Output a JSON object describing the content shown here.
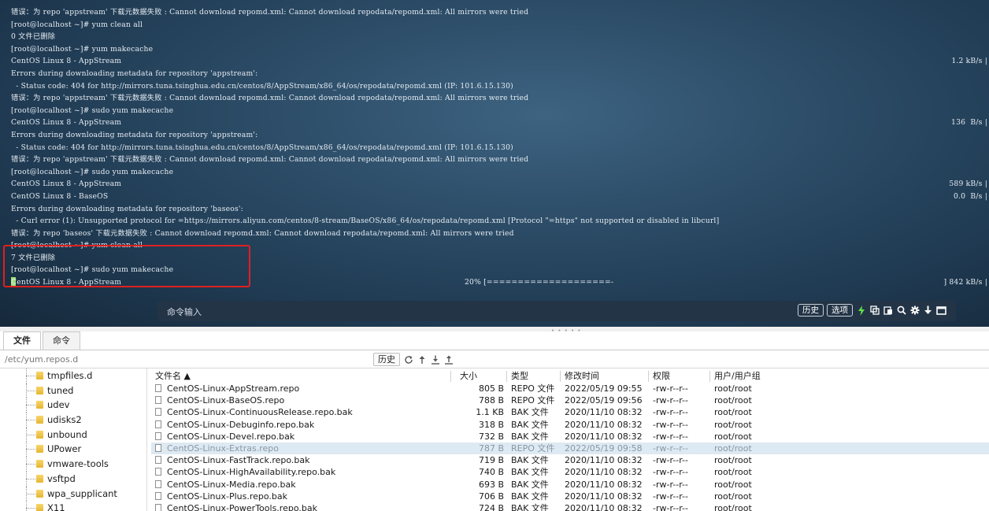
{
  "terminal": {
    "lines": [
      {
        "text": "错误：为 repo 'appstream' 下载元数据失败 : Cannot download repomd.xml: Cannot download repodata/repomd.xml: All mirrors were tried",
        "right": ""
      },
      {
        "text": "[root@localhost ~]# yum clean all",
        "right": ""
      },
      {
        "text": "0 文件已删除",
        "right": ""
      },
      {
        "text": "[root@localhost ~]# yum makecache",
        "right": ""
      },
      {
        "text": "CentOS Linux 8 - AppStream",
        "right": "1.2 kB/s |"
      },
      {
        "text": "Errors during downloading metadata for repository 'appstream':",
        "right": ""
      },
      {
        "text": "  - Status code: 404 for http://mirrors.tuna.tsinghua.edu.cn/centos/8/AppStream/x86_64/os/repodata/repomd.xml (IP: 101.6.15.130)",
        "right": ""
      },
      {
        "text": "错误：为 repo 'appstream' 下载元数据失败 : Cannot download repomd.xml: Cannot download repodata/repomd.xml: All mirrors were tried",
        "right": ""
      },
      {
        "text": "[root@localhost ~]# sudo yum makecache",
        "right": ""
      },
      {
        "text": "CentOS Linux 8 - AppStream",
        "right": "136  B/s |"
      },
      {
        "text": "Errors during downloading metadata for repository 'appstream':",
        "right": ""
      },
      {
        "text": "  - Status code: 404 for http://mirrors.tuna.tsinghua.edu.cn/centos/8/AppStream/x86_64/os/repodata/repomd.xml (IP: 101.6.15.130)",
        "right": ""
      },
      {
        "text": "错误：为 repo 'appstream' 下载元数据失败 : Cannot download repomd.xml: Cannot download repodata/repomd.xml: All mirrors were tried",
        "right": ""
      },
      {
        "text": "[root@localhost ~]# sudo yum makecache",
        "right": ""
      },
      {
        "text": "CentOS Linux 8 - AppStream",
        "right": "589 kB/s |"
      },
      {
        "text": "CentOS Linux 8 - BaseOS",
        "right": "0.0  B/s |"
      },
      {
        "text": "Errors during downloading metadata for repository 'baseos':",
        "right": ""
      },
      {
        "text": "  - Curl error (1): Unsupported protocol for =https://mirrors.aliyun.com/centos/8-stream/BaseOS/x86_64/os/repodata/repomd.xml [Protocol \"=https\" not supported or disabled in libcurl]",
        "right": ""
      },
      {
        "text": "错误：为 repo 'baseos' 下载元数据失败 : Cannot download repomd.xml: Cannot download repodata/repomd.xml: All mirrors were tried",
        "right": ""
      },
      {
        "text": "[root@localhost ~]# yum clean all",
        "right": ""
      },
      {
        "text": "7 文件已删除",
        "right": ""
      },
      {
        "text": "[root@localhost ~]# sudo yum makecache",
        "right": ""
      }
    ],
    "last_line": {
      "text": "CentOS Linux 8 - AppStream",
      "progress": "20% [====================-",
      "right": "] 842 kB/s |"
    },
    "highlight_color": "#e02020",
    "cursor_color": "#9fe07a"
  },
  "command_bar": {
    "placeholder": "命令输入",
    "history_label": "历史",
    "options_label": "选项",
    "icons": [
      "lightning-icon",
      "copy-icon",
      "paste-icon",
      "search-icon",
      "gear-icon",
      "download-arrow-icon",
      "window-icon"
    ]
  },
  "tabs": [
    {
      "label": "文件",
      "active": true
    },
    {
      "label": "命令",
      "active": false
    }
  ],
  "pathbar": {
    "path": "/etc/yum.repos.d",
    "history_label": "历史",
    "icons": [
      "refresh-icon",
      "up-dir-icon",
      "download-icon",
      "upload-icon"
    ]
  },
  "tree": {
    "items": [
      "tmpfiles.d",
      "tuned",
      "udev",
      "udisks2",
      "unbound",
      "UPower",
      "vmware-tools",
      "vsftpd",
      "wpa_supplicant",
      "X11"
    ]
  },
  "files": {
    "columns": {
      "name": "文件名 ▲",
      "size": "大小",
      "type": "类型",
      "mtime": "修改时间",
      "perm": "权限",
      "owner": "用户/用户组"
    },
    "rows": [
      {
        "name": "CentOS-Linux-AppStream.repo",
        "size": "805 B",
        "type": "REPO 文件",
        "mtime": "2022/05/19 09:55",
        "perm": "-rw-r--r--",
        "owner": "root/root"
      },
      {
        "name": "CentOS-Linux-BaseOS.repo",
        "size": "788 B",
        "type": "REPO 文件",
        "mtime": "2022/05/19 09:56",
        "perm": "-rw-r--r--",
        "owner": "root/root"
      },
      {
        "name": "CentOS-Linux-ContinuousRelease.repo.bak",
        "size": "1.1 KB",
        "type": "BAK 文件",
        "mtime": "2020/11/10 08:32",
        "perm": "-rw-r--r--",
        "owner": "root/root"
      },
      {
        "name": "CentOS-Linux-Debuginfo.repo.bak",
        "size": "318 B",
        "type": "BAK 文件",
        "mtime": "2020/11/10 08:32",
        "perm": "-rw-r--r--",
        "owner": "root/root"
      },
      {
        "name": "CentOS-Linux-Devel.repo.bak",
        "size": "732 B",
        "type": "BAK 文件",
        "mtime": "2020/11/10 08:32",
        "perm": "-rw-r--r--",
        "owner": "root/root"
      },
      {
        "name": "CentOS-Linux-Extras.repo",
        "size": "787 B",
        "type": "REPO 文件",
        "mtime": "2022/05/19 09:58",
        "perm": "-rw-r--r--",
        "owner": "root/root",
        "selected": true
      },
      {
        "name": "CentOS-Linux-FastTrack.repo.bak",
        "size": "719 B",
        "type": "BAK 文件",
        "mtime": "2020/11/10 08:32",
        "perm": "-rw-r--r--",
        "owner": "root/root"
      },
      {
        "name": "CentOS-Linux-HighAvailability.repo.bak",
        "size": "740 B",
        "type": "BAK 文件",
        "mtime": "2020/11/10 08:32",
        "perm": "-rw-r--r--",
        "owner": "root/root"
      },
      {
        "name": "CentOS-Linux-Media.repo.bak",
        "size": "693 B",
        "type": "BAK 文件",
        "mtime": "2020/11/10 08:32",
        "perm": "-rw-r--r--",
        "owner": "root/root"
      },
      {
        "name": "CentOS-Linux-Plus.repo.bak",
        "size": "706 B",
        "type": "BAK 文件",
        "mtime": "2020/11/10 08:32",
        "perm": "-rw-r--r--",
        "owner": "root/root"
      },
      {
        "name": "CentOS-Linux-PowerTools.repo.bak",
        "size": "724 B",
        "type": "BAK 文件",
        "mtime": "2020/11/10 08:32",
        "perm": "-rw-r--r--",
        "owner": "root/root"
      }
    ]
  },
  "colors": {
    "terminal_bg": "#2d4d68",
    "command_bar_bg": "#233447",
    "selected_row": "#dde9f3",
    "lightning": "#5fe04a"
  }
}
